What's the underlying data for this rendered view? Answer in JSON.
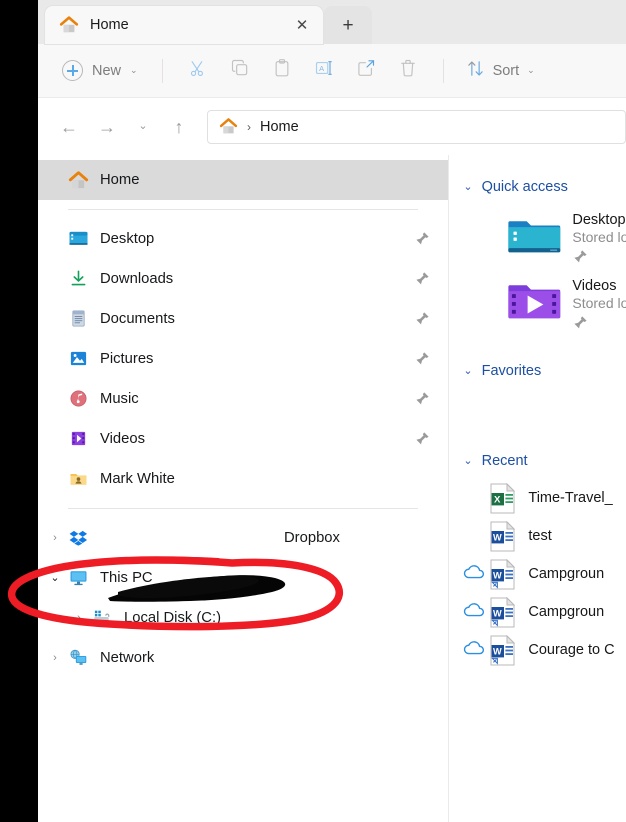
{
  "window": {
    "tab": {
      "title": "Home",
      "close_label": "✕",
      "new_tab_label": "+"
    }
  },
  "toolbar": {
    "new_label": "New",
    "new_chevron": "⌄",
    "cut_icon": "cut-icon",
    "copy_icon": "copy-icon",
    "paste_icon": "paste-icon",
    "rename_icon": "rename-icon",
    "share_icon": "share-icon",
    "delete_icon": "delete-icon",
    "sort_label": "Sort",
    "sort_chevron": "⌄"
  },
  "addressbar": {
    "back": "←",
    "forward": "→",
    "recent_chevron": "⌄",
    "up": "↑",
    "home_icon": "home-icon",
    "separator": "›",
    "path_text": "Home"
  },
  "navpane": {
    "selected": {
      "label": "Home",
      "icon": "home-icon"
    },
    "quick_items": [
      {
        "label": "Desktop",
        "icon": "desktop-folder-icon",
        "pinned": true
      },
      {
        "label": "Downloads",
        "icon": "downloads-icon",
        "pinned": true
      },
      {
        "label": "Documents",
        "icon": "documents-icon",
        "pinned": true
      },
      {
        "label": "Pictures",
        "icon": "pictures-icon",
        "pinned": true
      },
      {
        "label": "Music",
        "icon": "music-icon",
        "pinned": true
      },
      {
        "label": "Videos",
        "icon": "videos-icon",
        "pinned": true
      },
      {
        "label": "Mark White",
        "icon": "user-folder-icon",
        "pinned": false
      }
    ],
    "tree_items": [
      {
        "label": "Dropbox",
        "icon": "dropbox-icon",
        "chevron": "›",
        "expanded": false,
        "indent": 0,
        "redacted_prefix": true
      },
      {
        "label": "This PC",
        "icon": "thispc-icon",
        "chevron": "⌄",
        "expanded": true,
        "indent": 0,
        "redacted_prefix": false
      },
      {
        "label": "Local Disk (C:)",
        "icon": "localdisk-icon",
        "chevron": "›",
        "expanded": false,
        "indent": 1,
        "redacted_prefix": false
      },
      {
        "label": "Network",
        "icon": "network-icon",
        "chevron": "›",
        "expanded": false,
        "indent": 0,
        "redacted_prefix": false
      }
    ]
  },
  "mainpane": {
    "groups": [
      {
        "id": "quick_access",
        "title": "Quick access",
        "chevron": "⌄"
      },
      {
        "id": "favorites",
        "title": "Favorites",
        "chevron": "⌄"
      },
      {
        "id": "recent",
        "title": "Recent",
        "chevron": "⌄"
      }
    ],
    "quick_access": [
      {
        "name": "Desktop",
        "subtitle": "Stored lo",
        "icon": "desktop-folder-icon",
        "pinned": true
      },
      {
        "name": "Videos",
        "subtitle": "Stored lo",
        "icon": "videos-folder-icon",
        "pinned": true
      }
    ],
    "recent": [
      {
        "name": "Time-Travel_",
        "icon": "excel-file-icon",
        "cloud": false
      },
      {
        "name": "test",
        "icon": "word-file-icon",
        "cloud": false
      },
      {
        "name": "Campgroun",
        "icon": "word-file-icon",
        "cloud": true
      },
      {
        "name": "Campgroun",
        "icon": "word-file-icon",
        "cloud": true
      },
      {
        "name": "Courage to C",
        "icon": "word-file-icon",
        "cloud": true
      }
    ]
  },
  "annotations": {
    "red_ellipse": {
      "color": "#ee1c25",
      "target": "dropbox-row"
    },
    "black_redaction": {
      "color": "#000000",
      "target": "dropbox-account-name"
    }
  },
  "colors": {
    "accent_blue": "#1d4fa3",
    "tab_active": "#f8f8f8",
    "tabstrip": "#e9e9e9",
    "selection": "#dadada",
    "annotation_red": "#ee1c25"
  }
}
